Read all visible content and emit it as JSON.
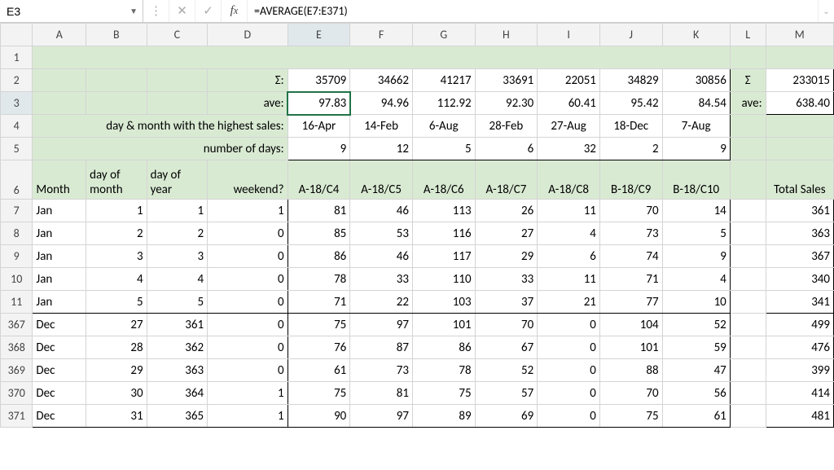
{
  "formula_bar": {
    "cell_ref": "E3",
    "formula": "=AVERAGE(E7:E371)"
  },
  "columns": [
    "A",
    "B",
    "C",
    "D",
    "E",
    "F",
    "G",
    "H",
    "I",
    "J",
    "K",
    "L",
    "M"
  ],
  "row_numbers_top": [
    "1",
    "2",
    "3",
    "4",
    "5",
    "6",
    "7",
    "8",
    "9",
    "10",
    "11"
  ],
  "row_numbers_bottom": [
    "367",
    "368",
    "369",
    "370",
    "371"
  ],
  "labels": {
    "sigma": "Σ:",
    "ave": "ave:",
    "highest": "day & month with the highest sales:",
    "ndays": "number of days:",
    "sigma2": "Σ",
    "ave2": "ave:"
  },
  "summary": {
    "sigma": [
      "35709",
      "34662",
      "41217",
      "33691",
      "22051",
      "34829",
      "30856"
    ],
    "ave": [
      "97.83",
      "94.96",
      "112.92",
      "92.30",
      "60.41",
      "95.42",
      "84.54"
    ],
    "highest": [
      "16-Apr",
      "14-Feb",
      "6-Aug",
      "28-Feb",
      "27-Aug",
      "18-Dec",
      "7-Aug"
    ],
    "ndays": [
      "9",
      "12",
      "5",
      "6",
      "32",
      "2",
      "9"
    ],
    "total_sigma": "233015",
    "total_ave": "638.40"
  },
  "headers": {
    "A": "Month",
    "B": "day of month",
    "C": "day of year",
    "D": "weekend?",
    "E": "A-18/C4",
    "F": "A-18/C5",
    "G": "A-18/C6",
    "H": "A-18/C7",
    "I": "A-18/C8",
    "J": "B-18/C9",
    "K": "B-18/C10",
    "M": "Total Sales"
  },
  "data_top": [
    {
      "m": "Jan",
      "dm": "1",
      "dy": "1",
      "we": "1",
      "v": [
        "81",
        "46",
        "113",
        "26",
        "11",
        "70",
        "14"
      ],
      "t": "361"
    },
    {
      "m": "Jan",
      "dm": "2",
      "dy": "2",
      "we": "0",
      "v": [
        "85",
        "53",
        "116",
        "27",
        "4",
        "73",
        "5"
      ],
      "t": "363"
    },
    {
      "m": "Jan",
      "dm": "3",
      "dy": "3",
      "we": "0",
      "v": [
        "86",
        "46",
        "117",
        "29",
        "6",
        "74",
        "9"
      ],
      "t": "367"
    },
    {
      "m": "Jan",
      "dm": "4",
      "dy": "4",
      "we": "0",
      "v": [
        "78",
        "33",
        "110",
        "33",
        "11",
        "71",
        "4"
      ],
      "t": "340"
    },
    {
      "m": "Jan",
      "dm": "5",
      "dy": "5",
      "we": "0",
      "v": [
        "71",
        "22",
        "103",
        "37",
        "21",
        "77",
        "10"
      ],
      "t": "341"
    }
  ],
  "data_bottom": [
    {
      "m": "Dec",
      "dm": "27",
      "dy": "361",
      "we": "0",
      "v": [
        "75",
        "97",
        "101",
        "70",
        "0",
        "104",
        "52"
      ],
      "t": "499"
    },
    {
      "m": "Dec",
      "dm": "28",
      "dy": "362",
      "we": "0",
      "v": [
        "76",
        "87",
        "86",
        "67",
        "0",
        "101",
        "59"
      ],
      "t": "476"
    },
    {
      "m": "Dec",
      "dm": "29",
      "dy": "363",
      "we": "0",
      "v": [
        "61",
        "73",
        "78",
        "52",
        "0",
        "88",
        "47"
      ],
      "t": "399"
    },
    {
      "m": "Dec",
      "dm": "30",
      "dy": "364",
      "we": "1",
      "v": [
        "75",
        "81",
        "75",
        "57",
        "0",
        "70",
        "56"
      ],
      "t": "414"
    },
    {
      "m": "Dec",
      "dm": "31",
      "dy": "365",
      "we": "1",
      "v": [
        "90",
        "97",
        "89",
        "69",
        "0",
        "75",
        "61"
      ],
      "t": "481"
    }
  ],
  "chart_data": {
    "type": "table",
    "title": "Daily sales by product with summary statistics",
    "columns_meta": [
      "Month",
      "day of month",
      "day of year",
      "weekend?",
      "A-18/C4",
      "A-18/C5",
      "A-18/C6",
      "A-18/C7",
      "A-18/C8",
      "B-18/C9",
      "B-18/C10",
      "Total Sales"
    ],
    "products": [
      "A-18/C4",
      "A-18/C5",
      "A-18/C6",
      "A-18/C7",
      "A-18/C8",
      "B-18/C9",
      "B-18/C10"
    ],
    "sum_by_product": [
      35709,
      34662,
      41217,
      33691,
      22051,
      34829,
      30856
    ],
    "avg_by_product": [
      97.83,
      94.96,
      112.92,
      92.3,
      60.41,
      95.42,
      84.54
    ],
    "peak_day_by_product": [
      "16-Apr",
      "14-Feb",
      "6-Aug",
      "28-Feb",
      "27-Aug",
      "18-Dec",
      "7-Aug"
    ],
    "peak_day_count": [
      9,
      12,
      5,
      6,
      32,
      2,
      9
    ],
    "grand_total_sum": 233015,
    "grand_total_avg": 638.4,
    "visible_rows": [
      {
        "Month": "Jan",
        "day_of_month": 1,
        "day_of_year": 1,
        "weekend": 1,
        "A-18/C4": 81,
        "A-18/C5": 46,
        "A-18/C6": 113,
        "A-18/C7": 26,
        "A-18/C8": 11,
        "B-18/C9": 70,
        "B-18/C10": 14,
        "Total": 361
      },
      {
        "Month": "Jan",
        "day_of_month": 2,
        "day_of_year": 2,
        "weekend": 0,
        "A-18/C4": 85,
        "A-18/C5": 53,
        "A-18/C6": 116,
        "A-18/C7": 27,
        "A-18/C8": 4,
        "B-18/C9": 73,
        "B-18/C10": 5,
        "Total": 363
      },
      {
        "Month": "Jan",
        "day_of_month": 3,
        "day_of_year": 3,
        "weekend": 0,
        "A-18/C4": 86,
        "A-18/C5": 46,
        "A-18/C6": 117,
        "A-18/C7": 29,
        "A-18/C8": 6,
        "B-18/C9": 74,
        "B-18/C10": 9,
        "Total": 367
      },
      {
        "Month": "Jan",
        "day_of_month": 4,
        "day_of_year": 4,
        "weekend": 0,
        "A-18/C4": 78,
        "A-18/C5": 33,
        "A-18/C6": 110,
        "A-18/C7": 33,
        "A-18/C8": 11,
        "B-18/C9": 71,
        "B-18/C10": 4,
        "Total": 340
      },
      {
        "Month": "Jan",
        "day_of_month": 5,
        "day_of_year": 5,
        "weekend": 0,
        "A-18/C4": 71,
        "A-18/C5": 22,
        "A-18/C6": 103,
        "A-18/C7": 37,
        "A-18/C8": 21,
        "B-18/C9": 77,
        "B-18/C10": 10,
        "Total": 341
      },
      {
        "Month": "Dec",
        "day_of_month": 27,
        "day_of_year": 361,
        "weekend": 0,
        "A-18/C4": 75,
        "A-18/C5": 97,
        "A-18/C6": 101,
        "A-18/C7": 70,
        "A-18/C8": 0,
        "B-18/C9": 104,
        "B-18/C10": 52,
        "Total": 499
      },
      {
        "Month": "Dec",
        "day_of_month": 28,
        "day_of_year": 362,
        "weekend": 0,
        "A-18/C4": 76,
        "A-18/C5": 87,
        "A-18/C6": 86,
        "A-18/C7": 67,
        "A-18/C8": 0,
        "B-18/C9": 101,
        "B-18/C10": 59,
        "Total": 476
      },
      {
        "Month": "Dec",
        "day_of_month": 29,
        "day_of_year": 363,
        "weekend": 0,
        "A-18/C4": 61,
        "A-18/C5": 73,
        "A-18/C6": 78,
        "A-18/C7": 52,
        "A-18/C8": 0,
        "B-18/C9": 88,
        "B-18/C10": 47,
        "Total": 399
      },
      {
        "Month": "Dec",
        "day_of_month": 30,
        "day_of_year": 364,
        "weekend": 1,
        "A-18/C4": 75,
        "A-18/C5": 81,
        "A-18/C6": 75,
        "A-18/C7": 57,
        "A-18/C8": 0,
        "B-18/C9": 70,
        "B-18/C10": 56,
        "Total": 414
      },
      {
        "Month": "Dec",
        "day_of_month": 31,
        "day_of_year": 365,
        "weekend": 1,
        "A-18/C4": 90,
        "A-18/C5": 97,
        "A-18/C6": 89,
        "A-18/C7": 69,
        "A-18/C8": 0,
        "B-18/C9": 75,
        "B-18/C10": 61,
        "Total": 481
      }
    ]
  }
}
